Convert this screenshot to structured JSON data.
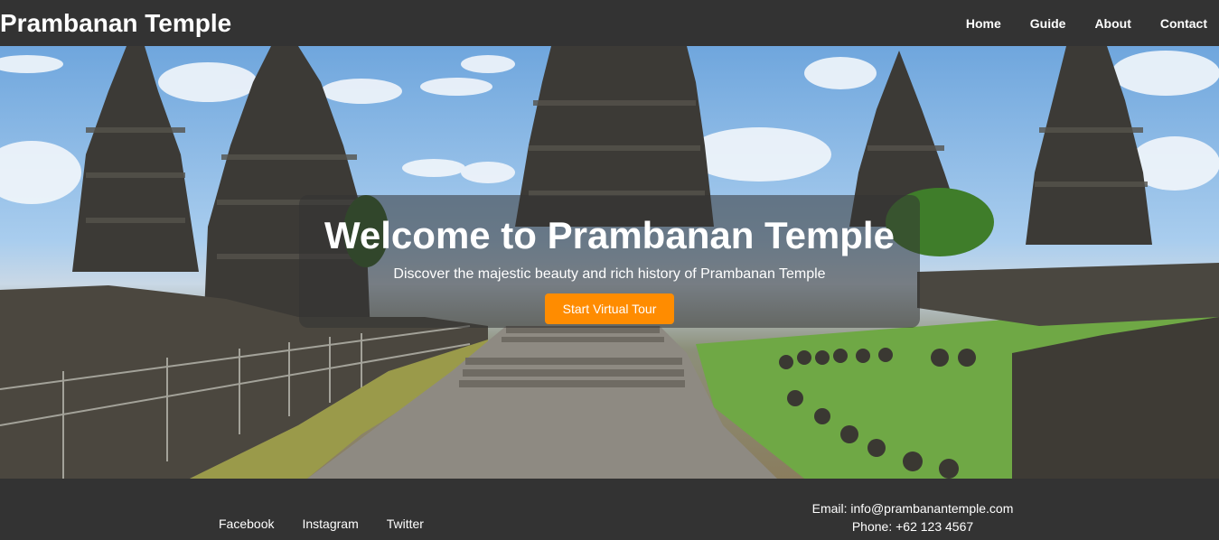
{
  "header": {
    "title": "Prambanan Temple",
    "nav": [
      "Home",
      "Guide",
      "About",
      "Contact"
    ]
  },
  "hero": {
    "heading": "Welcome to Prambanan Temple",
    "subheading": "Discover the majestic beauty and rich history of Prambanan Temple",
    "button_label": "Start Virtual Tour"
  },
  "footer": {
    "social": [
      "Facebook",
      "Instagram",
      "Twitter"
    ],
    "email": "Email: info@prambanantemple.com",
    "phone": "Phone: +62 123 4567"
  },
  "colors": {
    "bar_background": "#333333",
    "accent": "#ff8c00",
    "text": "#ffffff"
  }
}
